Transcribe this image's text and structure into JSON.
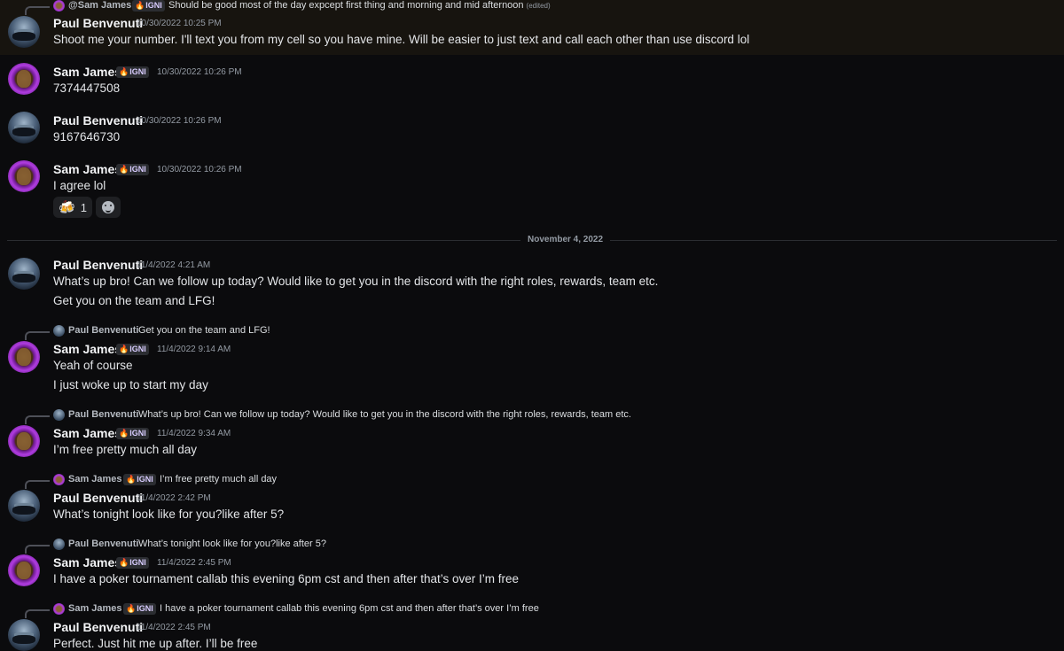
{
  "badge_label": "IGNI",
  "date_divider": "November 4, 2022",
  "messages": [
    {
      "author": "Paul Benvenuti",
      "timestamp": "10/30/2022 10:25 PM",
      "reply": {
        "author": "@Sam James",
        "text": "Should be good most of the day expcept first thing and morning and mid afternoon",
        "edited": "(edited)"
      },
      "lines": [
        "Shoot me your number. I'll text you from my cell so you have mine. Will be easier to just text and call each other than use discord lol"
      ]
    },
    {
      "author": "Sam James",
      "timestamp": "10/30/2022 10:26 PM",
      "lines": [
        "7374447508"
      ]
    },
    {
      "author": "Paul Benvenuti",
      "timestamp": "10/30/2022 10:26 PM",
      "lines": [
        "9167646730"
      ]
    },
    {
      "author": "Sam James",
      "timestamp": "10/30/2022 10:26 PM",
      "lines": [
        "I agree lol"
      ],
      "reaction": {
        "emoji": "🍻",
        "count": "1",
        "add_icon": "smiley-icon"
      }
    },
    {
      "author": "Paul Benvenuti",
      "timestamp": "11/4/2022 4:21 AM",
      "lines": [
        "What’s up bro! Can we follow up today? Would like to get you in the discord with the right roles, rewards, team etc.",
        "Get you on the team and LFG!"
      ]
    },
    {
      "author": "Sam James",
      "timestamp": "11/4/2022 9:14 AM",
      "reply": {
        "author": "Paul Benvenuti",
        "text": "Get you on the team and LFG!"
      },
      "lines": [
        "Yeah of course",
        "I just woke up to start my day"
      ]
    },
    {
      "author": "Sam James",
      "timestamp": "11/4/2022 9:34 AM",
      "reply": {
        "author": "Paul Benvenuti",
        "text": "What’s up bro! Can we follow up today? Would like to get you in the discord with the right roles, rewards, team etc."
      },
      "lines": [
        "I’m free pretty much all day"
      ]
    },
    {
      "author": "Paul Benvenuti",
      "timestamp": "11/4/2022 2:42 PM",
      "reply": {
        "author": "Sam James",
        "text": "I’m free pretty much all day"
      },
      "lines": [
        "What’s tonight look like for you?like after 5?"
      ]
    },
    {
      "author": "Sam James",
      "timestamp": "11/4/2022 2:45 PM",
      "reply": {
        "author": "Paul Benvenuti",
        "text": "What’s tonight look like for you?like after 5?"
      },
      "lines": [
        "I have a poker tournament callab this evening 6pm cst and then after that’s over I’m free"
      ]
    },
    {
      "author": "Paul Benvenuti",
      "timestamp": "11/4/2022 2:45 PM",
      "reply": {
        "author": "Sam James",
        "text": "I have a poker tournament callab this evening 6pm cst and then after that’s over I’m free"
      },
      "lines": [
        "Perfect. Just hit me up after. I’ll be free"
      ]
    }
  ]
}
